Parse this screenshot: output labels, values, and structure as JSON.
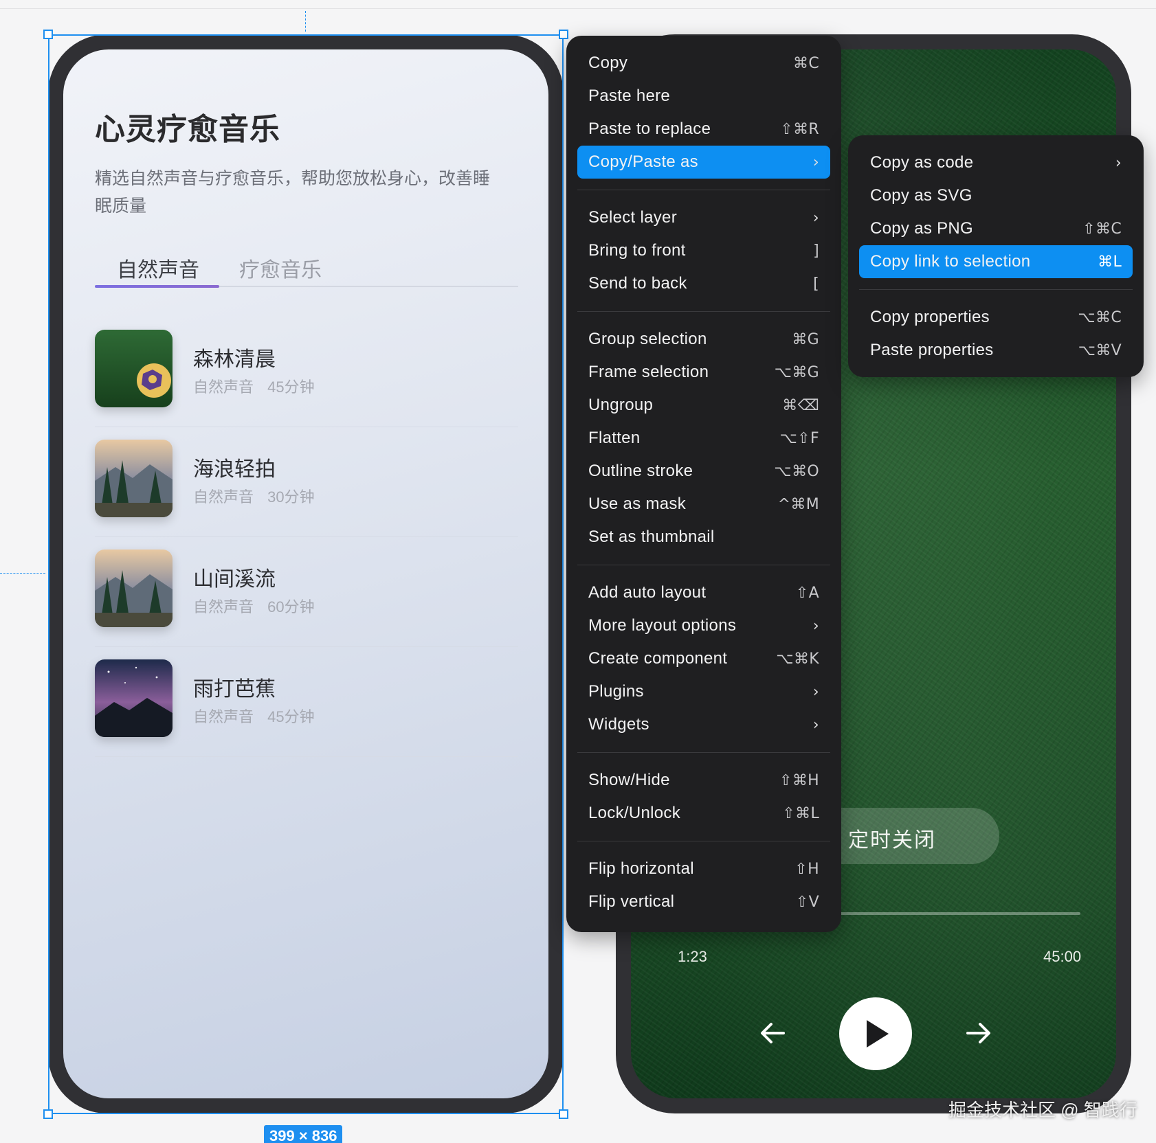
{
  "app": {
    "title": "心灵疗愈音乐",
    "description": "精选自然声音与疗愈音乐，帮助您放松身心，改善睡眠质量",
    "tabs": [
      "自然声音",
      "疗愈音乐"
    ],
    "active_tab": 0,
    "tracks": [
      {
        "name": "森林清晨",
        "category": "自然声音",
        "duration": "45分钟",
        "thumb": "soccer-ball-grass"
      },
      {
        "name": "海浪轻拍",
        "category": "自然声音",
        "duration": "30分钟",
        "thumb": "mountain-forest"
      },
      {
        "name": "山间溪流",
        "category": "自然声音",
        "duration": "60分钟",
        "thumb": "mountain-forest"
      },
      {
        "name": "雨打芭蕉",
        "category": "自然声音",
        "duration": "45分钟",
        "thumb": "night-sky-mountains"
      }
    ]
  },
  "selection": {
    "size_label": "399 × 836",
    "color": "#1e8ff0"
  },
  "player": {
    "timer_label": "定时关闭",
    "current_time": "1:23",
    "total_time": "45:00",
    "controls": [
      "arrow-left-icon",
      "play-icon",
      "arrow-right-icon"
    ]
  },
  "context_menu": {
    "groups": [
      [
        {
          "label": "Copy",
          "shortcut": "⌘C"
        },
        {
          "label": "Paste here",
          "shortcut": ""
        },
        {
          "label": "Paste to replace",
          "shortcut": "⇧⌘R"
        },
        {
          "label": "Copy/Paste as",
          "shortcut": "",
          "submenu": true,
          "highlighted": true
        }
      ],
      [
        {
          "label": "Select layer",
          "shortcut": "",
          "submenu": true
        },
        {
          "label": "Bring to front",
          "shortcut": "]"
        },
        {
          "label": "Send to back",
          "shortcut": "["
        }
      ],
      [
        {
          "label": "Group selection",
          "shortcut": "⌘G"
        },
        {
          "label": "Frame selection",
          "shortcut": "⌥⌘G"
        },
        {
          "label": "Ungroup",
          "shortcut": "⌘⌫"
        },
        {
          "label": "Flatten",
          "shortcut": "⌥⇧F"
        },
        {
          "label": "Outline stroke",
          "shortcut": "⌥⌘O"
        },
        {
          "label": "Use as mask",
          "shortcut": "^⌘M"
        },
        {
          "label": "Set as thumbnail",
          "shortcut": ""
        }
      ],
      [
        {
          "label": "Add auto layout",
          "shortcut": "⇧A"
        },
        {
          "label": "More layout options",
          "shortcut": "",
          "submenu": true
        },
        {
          "label": "Create component",
          "shortcut": "⌥⌘K"
        },
        {
          "label": "Plugins",
          "shortcut": "",
          "submenu": true
        },
        {
          "label": "Widgets",
          "shortcut": "",
          "submenu": true
        }
      ],
      [
        {
          "label": "Show/Hide",
          "shortcut": "⇧⌘H"
        },
        {
          "label": "Lock/Unlock",
          "shortcut": "⇧⌘L"
        }
      ],
      [
        {
          "label": "Flip horizontal",
          "shortcut": "⇧H"
        },
        {
          "label": "Flip vertical",
          "shortcut": "⇧V"
        }
      ]
    ]
  },
  "submenu": {
    "groups": [
      [
        {
          "label": "Copy as code",
          "shortcut": "",
          "submenu": true
        },
        {
          "label": "Copy as SVG",
          "shortcut": ""
        },
        {
          "label": "Copy as PNG",
          "shortcut": "⇧⌘C"
        },
        {
          "label": "Copy link to selection",
          "shortcut": "⌘L",
          "highlighted": true
        }
      ],
      [
        {
          "label": "Copy properties",
          "shortcut": "⌥⌘C"
        },
        {
          "label": "Paste properties",
          "shortcut": "⌥⌘V"
        }
      ]
    ]
  },
  "colors": {
    "menu_bg": "#1f1f21",
    "highlight": "#0d8ff2",
    "accent_tab": "#7c6fe0"
  },
  "watermark": "掘金技术社区 @ 智践行"
}
